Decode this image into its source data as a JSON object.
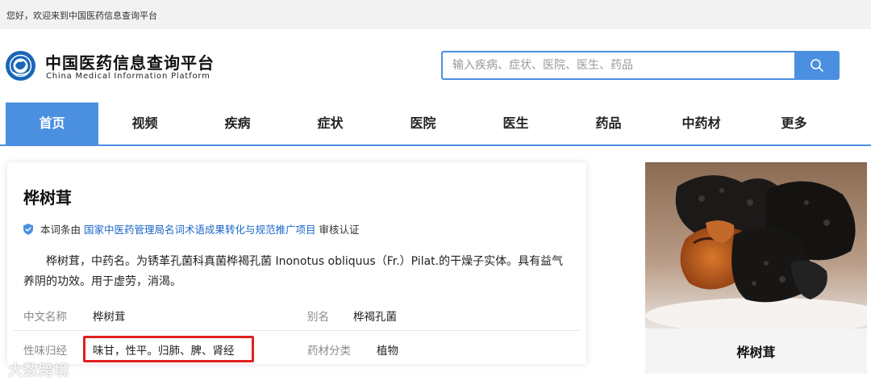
{
  "topbar": {
    "welcome": "您好，欢迎来到中国医药信息查询平台"
  },
  "header": {
    "title": "中国医药信息查询平台",
    "subtitle": "China Medical Information Platform",
    "search_placeholder": "输入疾病、症状、医院、医生、药品",
    "search_icon": "search-icon"
  },
  "nav": {
    "items": [
      {
        "label": "首页",
        "active": true
      },
      {
        "label": "视频"
      },
      {
        "label": "疾病"
      },
      {
        "label": "症状"
      },
      {
        "label": "医院"
      },
      {
        "label": "医生"
      },
      {
        "label": "药品"
      },
      {
        "label": "中药材"
      },
      {
        "label": "更多"
      }
    ]
  },
  "entry": {
    "title": "桦树茸",
    "cert_prefix": "本词条由",
    "cert_link": "国家中医药管理局名词术语成果转化与规范推广项目",
    "cert_suffix": "审核认证",
    "description": "桦树茸，中药名。为锈革孔菌科真菌桦褐孔菌 Inonotus obliquus（Fr.）Pilat.的干燥子实体。具有益气养阴的功效。用于虚劳，消渴。",
    "fields": {
      "cn_name_label": "中文名称",
      "cn_name_value": "桦树茸",
      "alias_label": "别名",
      "alias_value": "桦褐孔菌",
      "taste_label": "性味归经",
      "taste_value": "味甘，性平。归肺、脾、肾经",
      "category_label": "药材分类",
      "category_value": "植物"
    }
  },
  "image_card": {
    "caption": "桦树茸"
  },
  "watermark": "大数跨境",
  "colors": {
    "accent": "#4a8fe0",
    "link": "#1a66c8",
    "highlight": "#e02020"
  }
}
